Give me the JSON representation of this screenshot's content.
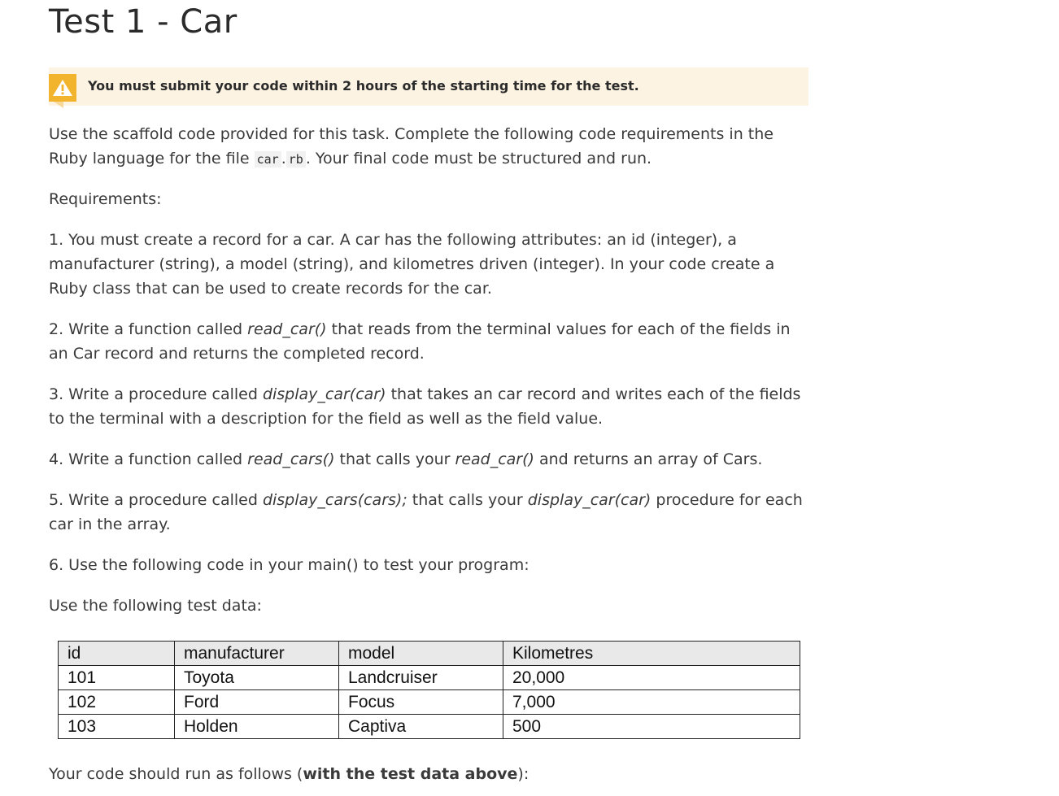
{
  "title": "Test 1 - Car",
  "warning": {
    "text": "You must submit your code within 2 hours of the starting time for the test.",
    "icon": "warning-triangle-icon",
    "color": "#f2b42c"
  },
  "intro": {
    "part1": "Use the scaffold code provided for this task. Complete the following code requirements in the Ruby language for the file ",
    "code1": "car",
    "dot": ".",
    "code2": "rb",
    "part2": ". Your final code must be structured and run."
  },
  "requirements_label": "Requirements:",
  "req1": "1. You must create a record for a car. A car has the following attributes: an id (integer), a manufacturer (string), a model (string), and kilometres driven (integer). In your code create a Ruby class that can be used to create records for the car.",
  "req2": {
    "a": "2. Write a function called ",
    "em": "read_car()",
    "b": " that reads from the terminal values for each of the fields in an Car record and returns the completed record."
  },
  "req3": {
    "a": "3. Write a procedure called ",
    "em": "display_car(car)",
    "b": " that takes an car record and writes each of the fields to the terminal with a description for the field as well as the field value."
  },
  "req4": {
    "a": "4. Write a function called ",
    "em1": "read_cars()",
    "b": " that calls your ",
    "em2": "read_car()",
    "c": " and returns an array of Cars."
  },
  "req5": {
    "a": "5. Write a procedure called ",
    "em1": "display_cars(cars);",
    "b": " that calls your ",
    "em2": "display_car(car)",
    "c": " procedure for each car in the array."
  },
  "req6": "6. Use the following code in your main() to test your program:",
  "test_data_label": "Use the following test data:",
  "table": {
    "headers": [
      "id",
      "manufacturer",
      "model",
      "Kilometres"
    ],
    "rows": [
      [
        "101",
        "Toyota",
        "Landcruiser",
        "20,000"
      ],
      [
        "102",
        "Ford",
        "Focus",
        "7,000"
      ],
      [
        "103",
        "Holden",
        "Captiva",
        "500"
      ]
    ]
  },
  "footer": {
    "a": "Your code should run as follows (",
    "bold": "with the test data above",
    "b": "):"
  }
}
